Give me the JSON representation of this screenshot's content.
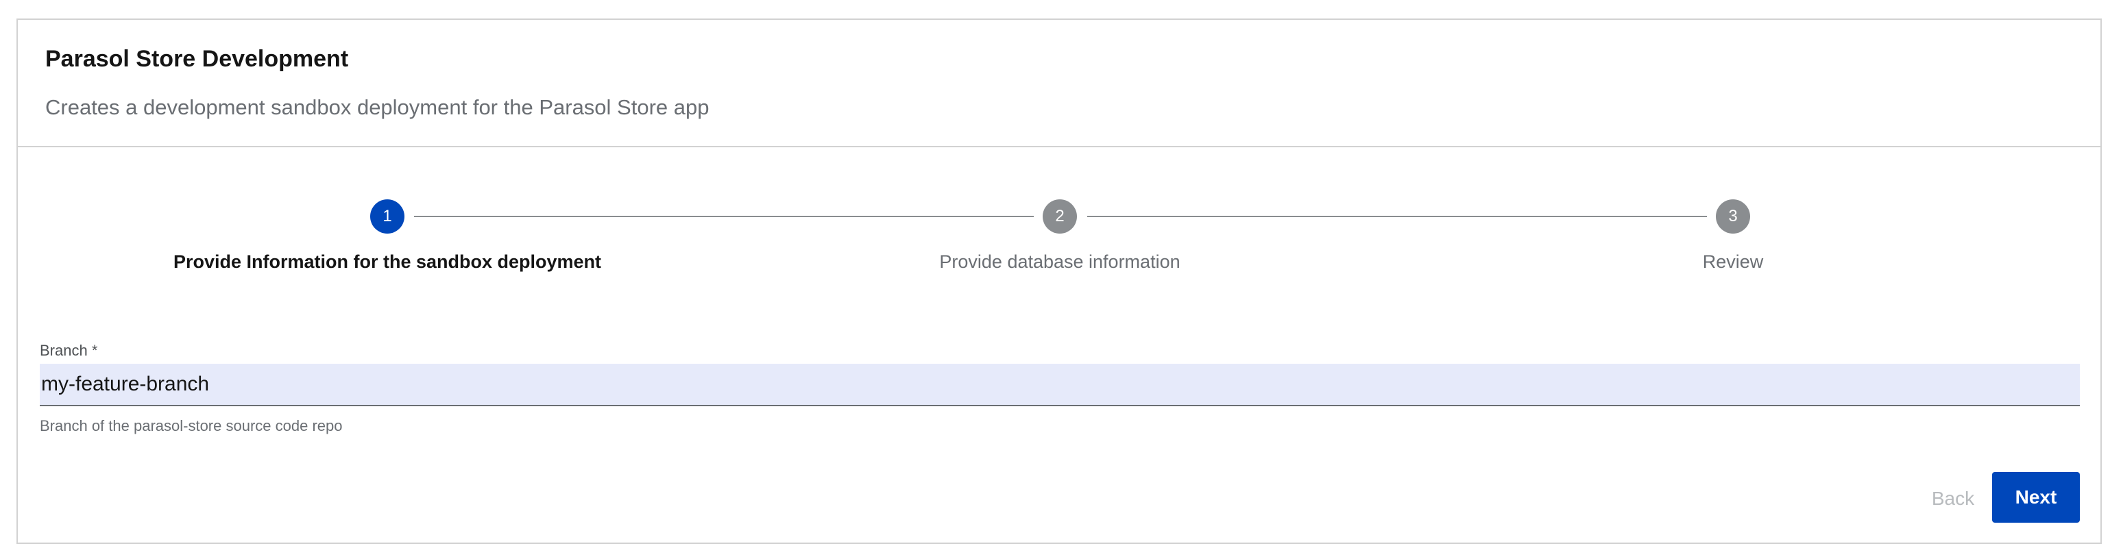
{
  "card": {
    "title": "Parasol Store Development",
    "subtitle": "Creates a development sandbox deployment for the Parasol Store app"
  },
  "stepper": {
    "steps": [
      {
        "number": "1",
        "label": "Provide Information for the sandbox deployment",
        "state": "active"
      },
      {
        "number": "2",
        "label": "Provide database information",
        "state": "inactive"
      },
      {
        "number": "3",
        "label": "Review",
        "state": "inactive"
      }
    ]
  },
  "form": {
    "branch": {
      "label": "Branch *",
      "value": "my-feature-branch",
      "helper": "Branch of the parasol-store source code repo"
    }
  },
  "actions": {
    "back_label": "Back",
    "next_label": "Next"
  },
  "colors": {
    "primary": "#0047ba",
    "inactive_step": "#8a8d90",
    "input_background": "#e6eafa",
    "border": "#d2d2d2",
    "disabled_text": "#b8bbbe"
  }
}
